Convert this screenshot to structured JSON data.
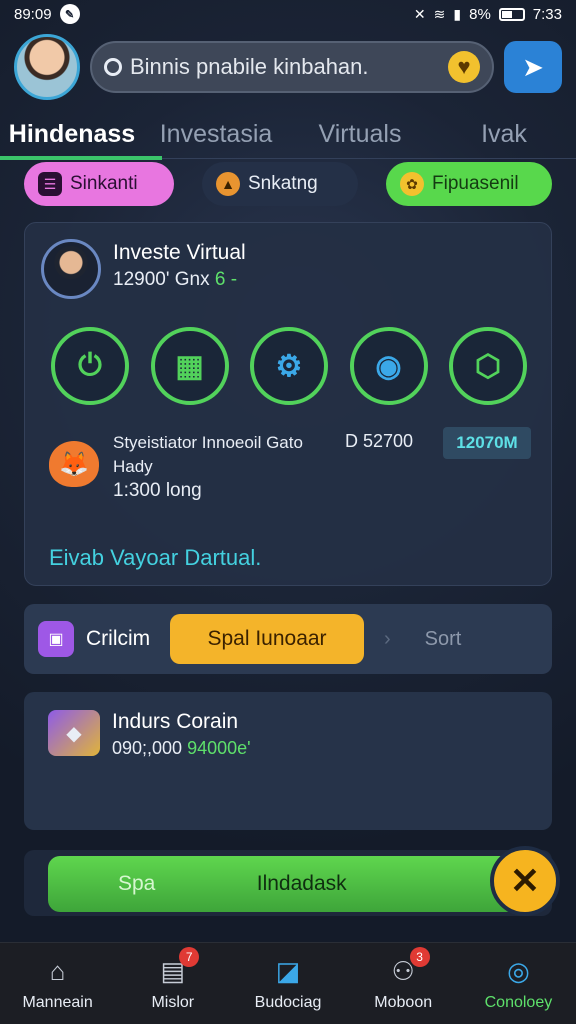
{
  "status_bar": {
    "time": "89:09",
    "battery": "8%",
    "clock_right": "7:33"
  },
  "header": {
    "search_text": "Binnis pnabile  kinbahan.",
    "icons": [
      "avatar",
      "pin-icon",
      "coin-icon",
      "send-icon"
    ]
  },
  "tabs": [
    {
      "label": "Hindenass",
      "active": true
    },
    {
      "label": "Investasia",
      "active": false
    },
    {
      "label": "Virtuals",
      "active": false
    },
    {
      "label": "Ivak",
      "active": false
    }
  ],
  "chips": [
    {
      "label": "Sinkanti",
      "icon": "list-icon"
    },
    {
      "label": "Snkatng",
      "icon": "triangle-coin-icon"
    },
    {
      "label": "Fipuasenil",
      "icon": "gear-coin-icon"
    }
  ],
  "invest_card": {
    "title": "Investe Virtual",
    "amount": "12900' Gnx",
    "amount_tail": "6 -",
    "row_text_1": "Styeistiator Innoeoil Gato",
    "row_text_2": "Hady",
    "row_text_3": "1:300 long",
    "row_amount": "D 52700",
    "row_badge": "12070M",
    "footer": "Eivab Vayoar Dartual.",
    "circle_icons": [
      "power-icon",
      "box-icon",
      "puzzle-icon",
      "gear-icon",
      "cube-icon"
    ],
    "circle_glyphs": [
      "⏻",
      "▦",
      "⚙",
      "◉",
      "⬡"
    ]
  },
  "action_card": {
    "label": "Crilcim",
    "button": "Spal Iunoaar",
    "chevron": "›",
    "sort": "Sort"
  },
  "industry_card": {
    "title": "Indurs Corain",
    "amount": "090;,000",
    "amount_green": "94000e'"
  },
  "cta": {
    "left": "Spa",
    "main": "Ilndadask",
    "close": "✕"
  },
  "bottom_nav": [
    {
      "label": "Manneain",
      "icon": "home-icon",
      "glyph": "⌂",
      "badge": ""
    },
    {
      "label": "Mislor",
      "icon": "calendar-icon",
      "glyph": "▤",
      "badge": "7"
    },
    {
      "label": "Budociag",
      "icon": "chart-icon",
      "glyph": "◪",
      "badge": ""
    },
    {
      "label": "Moboon",
      "icon": "robot-icon",
      "glyph": "⚇",
      "badge": "3"
    },
    {
      "label": "Conoloey",
      "icon": "globe-icon",
      "glyph": "◎",
      "badge": ""
    }
  ],
  "colors": {
    "accent": "#3bc46a",
    "bg": "#182133",
    "orange": "#f4b42a",
    "pink": "#e876e0"
  }
}
